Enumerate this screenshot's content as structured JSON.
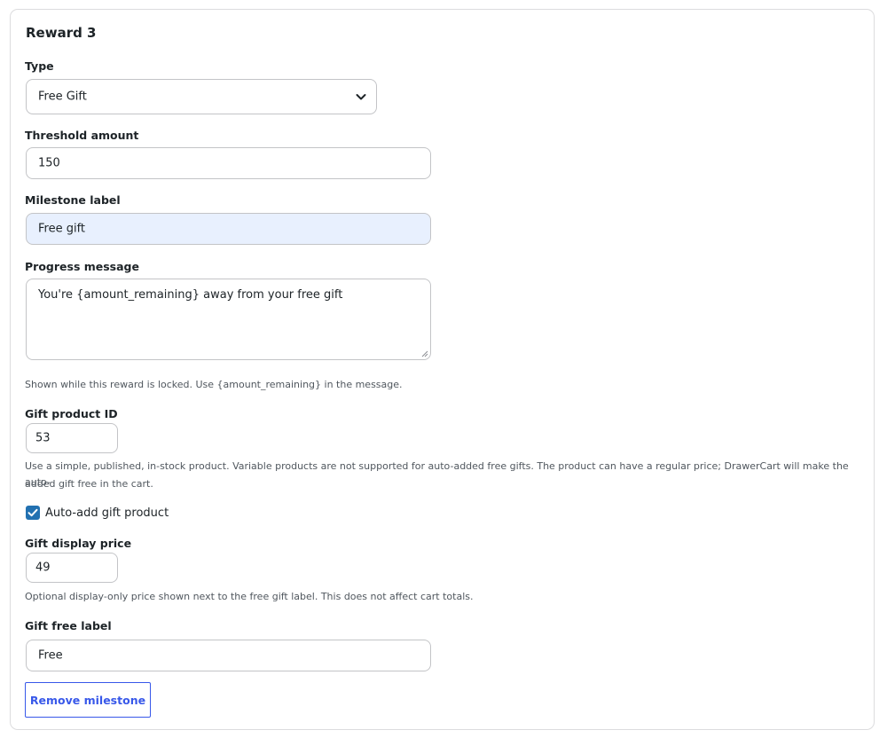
{
  "reward": {
    "title": "Reward 3",
    "type": {
      "label": "Type",
      "value": "Free Gift"
    },
    "threshold": {
      "label": "Threshold amount",
      "value": "150"
    },
    "milestone": {
      "label": "Milestone label",
      "value": "Free gift"
    },
    "progress": {
      "label": "Progress message",
      "value": "You're {amount_remaining} away from your free gift",
      "help": "Shown while this reward is locked. Use {amount_remaining} in the message."
    },
    "gift_product": {
      "label": "Gift product ID",
      "value": "53",
      "help_line1": "Use a simple, published, in-stock product. Variable products are not supported for auto-added free gifts. The product can have a regular price; DrawerCart will make the auto-",
      "help_line2": "added gift free in the cart."
    },
    "auto_add": {
      "label": "Auto-add gift product",
      "checked": true
    },
    "display_price": {
      "label": "Gift display price",
      "value": "49",
      "help": "Optional display-only price shown next to the free gift label. This does not affect cart totals."
    },
    "free_label": {
      "label": "Gift free label",
      "value": "Free"
    },
    "remove_button": "Remove milestone"
  },
  "colors": {
    "accent": "#3858e9",
    "checkbox": "#2271b1",
    "highlight_bg": "#e8f0fe",
    "border": "#c3c4c7"
  },
  "icons": {
    "select": "chevron-down-icon",
    "checkbox": "checkmark-icon",
    "textarea": "resize-grip-icon"
  }
}
